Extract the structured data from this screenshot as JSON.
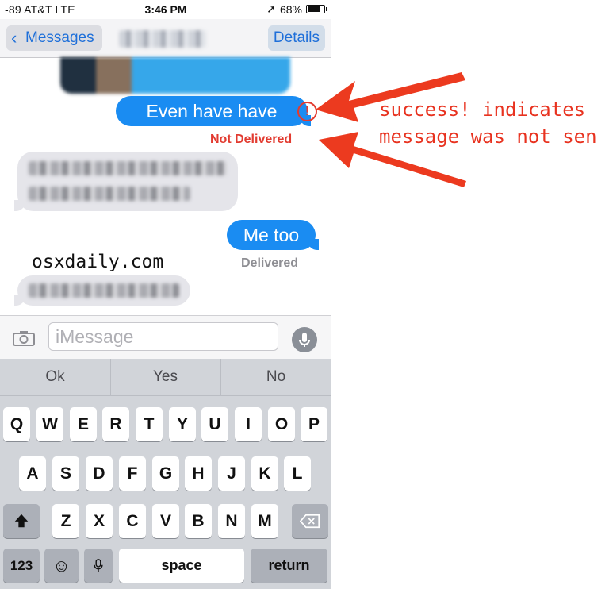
{
  "status_bar": {
    "carrier": "-89 AT&T  LTE",
    "time": "3:46 PM",
    "battery": "68%",
    "battery_level": 0.68
  },
  "nav": {
    "back_label": "Messages",
    "details_label": "Details"
  },
  "messages": {
    "sent_1": "Even have have",
    "sent_1_status": "Not Delivered",
    "sent_2": "Me too",
    "sent_2_status": "Delivered"
  },
  "watermark": "osxdaily.com",
  "input": {
    "placeholder": "iMessage"
  },
  "predictive": [
    "Ok",
    "Yes",
    "No"
  ],
  "keyboard": {
    "row1": [
      "Q",
      "W",
      "E",
      "R",
      "T",
      "Y",
      "U",
      "I",
      "O",
      "P"
    ],
    "row2": [
      "A",
      "S",
      "D",
      "F",
      "G",
      "H",
      "J",
      "K",
      "L"
    ],
    "row3": [
      "Z",
      "X",
      "C",
      "V",
      "B",
      "N",
      "M"
    ],
    "numbers_label": "123",
    "space_label": "space",
    "return_label": "return"
  },
  "annotation": {
    "line1": "success! indicates",
    "line2": "message was not sen"
  },
  "colors": {
    "ios_blue": "#1a8cf2",
    "error_red": "#e23b30",
    "annotation_red": "#e8321f"
  }
}
